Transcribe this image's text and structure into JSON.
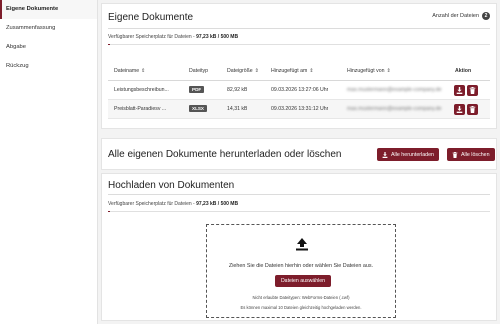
{
  "sidebar": {
    "items": [
      {
        "label": "Eigene Dokumente"
      },
      {
        "label": "Zusammenfassung"
      },
      {
        "label": "Abgabe"
      },
      {
        "label": "Rückzug"
      }
    ]
  },
  "documents": {
    "title": "Eigene Dokumente",
    "count_label": "Anzahl der Dateien",
    "count": "2",
    "storage_label": "Verfügbarer Speicherplatz für Dateien -",
    "storage_value": "97,23 kB / 500 MB",
    "storage_used_fraction": 0.0002,
    "columns": {
      "name": "Dateiname",
      "type": "Dateityp",
      "size": "Dateigröße",
      "added": "Hinzugefügt am",
      "added_by": "Hinzugefügt von",
      "action": "Aktion"
    },
    "rows": [
      {
        "name": "Leistungsbeschreibun...",
        "type": "PDF",
        "size": "82,92 kB",
        "added": "09.03.2026 13:27:06 Uhr",
        "added_by": "max.mustermann@example-company.de"
      },
      {
        "name": "Preisblatt-Paradiesv ...",
        "type": "XLSX",
        "size": "14,31 kB",
        "added": "09.03.2026 13:31:12 Uhr",
        "added_by": "max.mustermann@example-company.de"
      }
    ]
  },
  "bulk": {
    "title": "Alle eigenen Dokumente herunterladen oder löschen",
    "download_label": "Alle herunterladen",
    "delete_label": "Alle löschen"
  },
  "upload": {
    "title": "Hochladen von Dokumenten",
    "storage_label": "Verfügbarer Speicherplatz für Dateien -",
    "storage_value": "97,23 kB / 500 MB",
    "drop_text": "Ziehen Sie die Dateien hierhin oder wählen Sie Dateien aus.",
    "select_label": "Dateien auswählen",
    "allowed_note": "Nicht erlaubte Dateitypen: WebForms-Dateien (.cwf)",
    "max_note": "Es können maximal 10 Dateien gleichzeitig hochgeladen werden."
  },
  "colors": {
    "accent": "#7d1d2b"
  }
}
